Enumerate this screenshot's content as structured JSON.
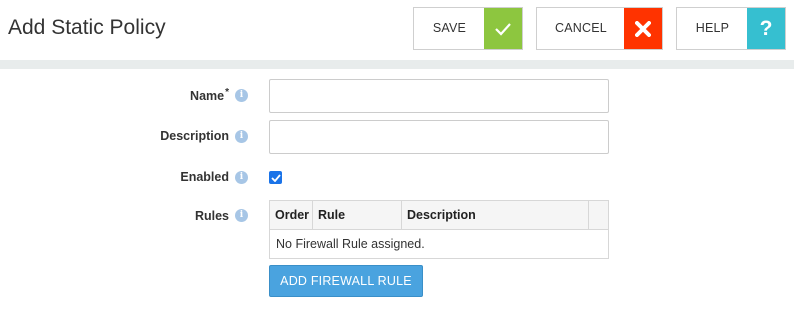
{
  "header": {
    "title": "Add Static Policy",
    "save_label": "SAVE",
    "cancel_label": "CANCEL",
    "help_label": "HELP",
    "help_icon_glyph": "?",
    "save_icon": "check-icon",
    "cancel_icon": "close-icon",
    "help_icon": "question-icon",
    "colors": {
      "save_accent": "#8dc63f",
      "cancel_accent": "#ff3300",
      "help_accent": "#36bfd0"
    }
  },
  "form": {
    "name": {
      "label": "Name",
      "required_marker": "*",
      "value": "",
      "info_icon": "info-icon"
    },
    "description": {
      "label": "Description",
      "value": "",
      "info_icon": "info-icon"
    },
    "enabled": {
      "label": "Enabled",
      "checked": true,
      "info_icon": "info-icon"
    },
    "rules": {
      "label": "Rules",
      "info_icon": "info-icon",
      "columns": [
        "Order",
        "Rule",
        "Description",
        ""
      ],
      "rows": [],
      "empty_message": "No Firewall Rule assigned.",
      "add_button_label": "ADD FIREWALL RULE",
      "add_button_color": "#4aa3df"
    }
  }
}
